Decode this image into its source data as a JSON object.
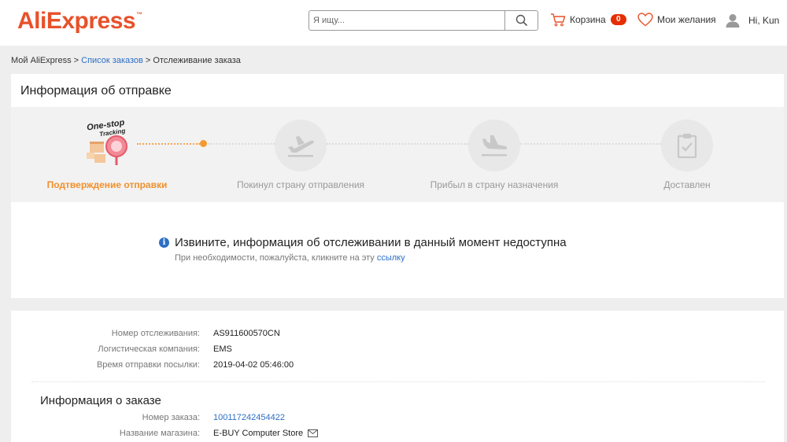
{
  "header": {
    "logo": "AliExpress",
    "search_placeholder": "Я ищу...",
    "cart_label": "Корзина",
    "cart_count": "0",
    "wishlist_label": "Мои желания",
    "user_greeting": "Hi, Kun"
  },
  "breadcrumb": {
    "home": "Мой AliExpress",
    "sep1": " > ",
    "orders": "Список заказов",
    "sep2": " > ",
    "current": "Отслеживание заказа"
  },
  "shipping": {
    "title": "Информация об отправке",
    "logo_text_line1": "One-stop",
    "logo_text_line2": "Tracking",
    "steps": [
      {
        "label": "Подтверждение отправки",
        "icon": "package-icon",
        "active": true
      },
      {
        "label": "Покинул страну отправления",
        "icon": "plane-takeoff-icon",
        "active": false
      },
      {
        "label": "Прибыл в страну назначения",
        "icon": "plane-landing-icon",
        "active": false
      },
      {
        "label": "Доставлен",
        "icon": "clipboard-check-icon",
        "active": false
      }
    ],
    "notice_title": "Извините, информация об отслеживании в данный момент недоступна",
    "notice_sub": "При необходимости, пожалуйста, кликните на эту ",
    "notice_link": "ссылку"
  },
  "tracking": {
    "number_label": "Номер отслеживания:",
    "number": "AS911600570CN",
    "company_label": "Логистическая компания:",
    "company": "EMS",
    "sent_label": "Время отправки посылки:",
    "sent": "2019-04-02 05:46:00"
  },
  "order": {
    "title": "Информация о заказе",
    "number_label": "Номер заказа:",
    "number": "100117242454422",
    "store_label": "Название магазина:",
    "store": "E-BUY Computer Store"
  },
  "colors": {
    "brand": "#e8512a",
    "accent": "#f0902c",
    "link": "#2c6fc6",
    "badge": "#e62e04"
  }
}
